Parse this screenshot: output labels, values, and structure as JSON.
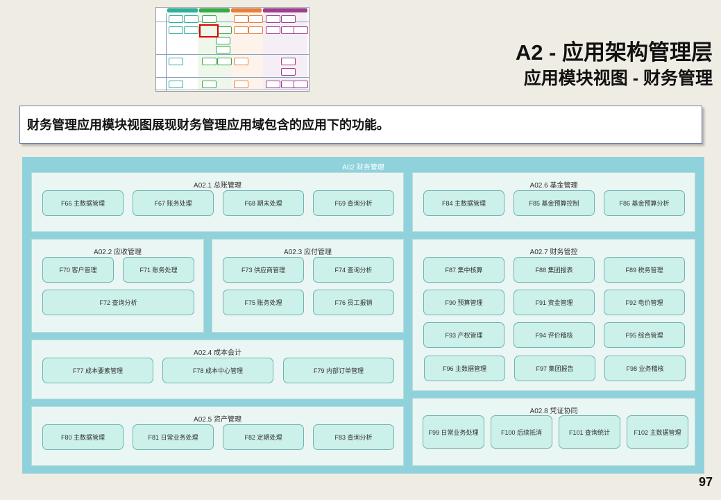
{
  "header": {
    "title": "A2 - 应用架构管理层",
    "subtitle": "应用模块视图 - 财务管理"
  },
  "description": "财务管理应用模块视图展现财务管理应用域包含的应用下的功能。",
  "domain_title": "A02 财务管理",
  "panels": {
    "gl": {
      "title": "A02.1 总账管理",
      "items": [
        "F66 主数据管理",
        "F67 账务处理",
        "F68 期末处理",
        "F69 查询分析"
      ]
    },
    "fund": {
      "title": "A02.6 基金管理",
      "items": [
        "F84 主数据管理",
        "F85 基金预算控制",
        "F86 基金预算分析"
      ]
    },
    "ar": {
      "title": "A02.2 应收管理",
      "items": [
        "F70 客户管理",
        "F71 账务处理",
        "F72 查询分析"
      ]
    },
    "ap": {
      "title": "A02.3 应付管理",
      "items": [
        "F73 供应商管理",
        "F74 查询分析",
        "F75 账务处理",
        "F76 员工报销"
      ]
    },
    "control": {
      "title": "A02.7 财务管控",
      "items": [
        "F87 集中核算",
        "F88 集团报表",
        "F89 税务管理",
        "F90 预算管理",
        "F91 资金管理",
        "F92 电价管理",
        "F93 产权管理",
        "F94 评价稽核",
        "F95 综合管理",
        "F96 主数据管理",
        "F97 集团报告",
        "F98 业务稽核"
      ]
    },
    "cost": {
      "title": "A02.4 成本会计",
      "items": [
        "F77 成本要素管理",
        "F78 成本中心管理",
        "F79 内部订单管理"
      ]
    },
    "asset": {
      "title": "A02.5 资产管理",
      "items": [
        "F80 主数据管理",
        "F81 日常业务处理",
        "F82 定期处理",
        "F83 查询分析"
      ]
    },
    "voucher": {
      "title": "A02.8 凭证协同",
      "items": [
        "F99 日常业务处理",
        "F100 后续抵消",
        "F101 查询统计",
        "F102 主数据管理"
      ]
    }
  },
  "page_number": "97",
  "colors": {
    "background": "#efece4",
    "outer": "#8fd2dc",
    "panel": "#eaf6f3",
    "box": "#ccf0ea",
    "box_border": "#6fb3b0",
    "desc_border": "#6a7cb0",
    "highlight": "#e00000"
  }
}
